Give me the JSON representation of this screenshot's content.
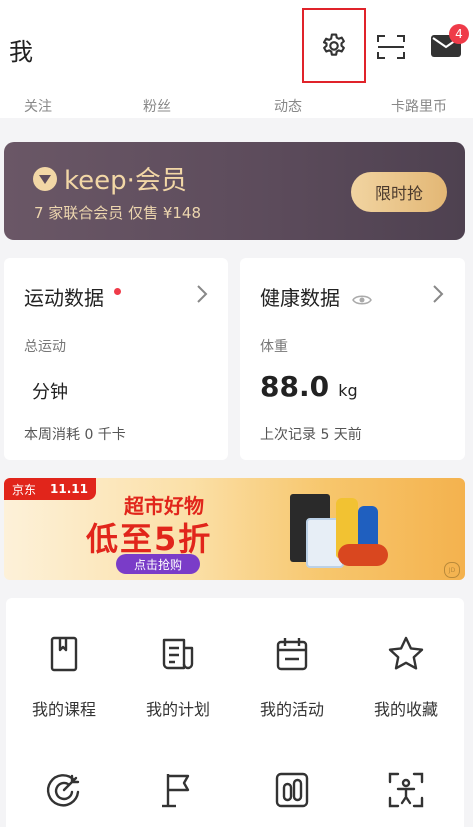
{
  "header": {
    "title": "我",
    "mail_badge": "4"
  },
  "stats": [
    "关注",
    "粉丝",
    "动态",
    "卡路里币"
  ],
  "vip": {
    "logo_text": "keep·会员",
    "subtitle": "7 家联合会员 仅售 ¥148",
    "button": "限时抢"
  },
  "sports_card": {
    "title": "运动数据",
    "label": "总运动",
    "value": "分钟",
    "footer": "本周消耗 0 千卡"
  },
  "health_card": {
    "title": "健康数据",
    "label": "体重",
    "value": "88.0",
    "unit": "kg",
    "footer": "上次记录 5 天前"
  },
  "banner": {
    "brand": "京东",
    "event": "11.11",
    "headline": "超市好物",
    "discount": "低至5折",
    "cta": "点击抢购",
    "corner": "JD"
  },
  "grid": {
    "row1": [
      "我的课程",
      "我的计划",
      "我的活动",
      "我的收藏"
    ]
  },
  "colors": {
    "accent_red": "#e0232a",
    "vip_gold": "#f2d7a6",
    "badge": "#ef3b49"
  }
}
